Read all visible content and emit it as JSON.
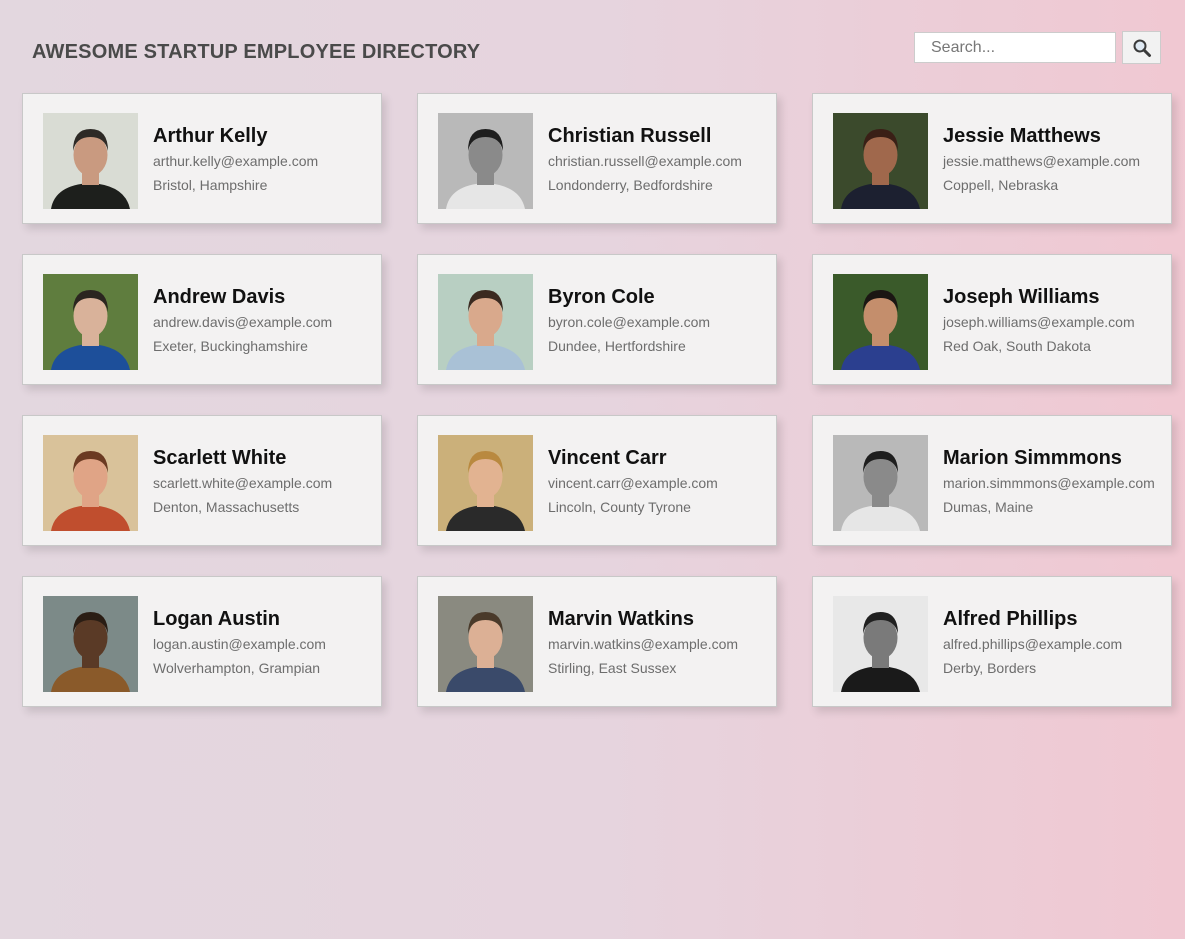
{
  "header": {
    "title": "AWESOME STARTUP EMPLOYEE DIRECTORY",
    "search_placeholder": "Search..."
  },
  "employees": [
    {
      "name": "Arthur Kelly",
      "email": "arthur.kelly@example.com",
      "location": "Bristol, Hampshire",
      "bg": "#d9dcd4",
      "skin": "#c99a80",
      "hair": "#2e2a26",
      "shirt": "#1d1f1c"
    },
    {
      "name": "Christian Russell",
      "email": "christian.russell@example.com",
      "location": "Londonderry, Bedfordshire",
      "bg": "#b9b9b9",
      "skin": "#8a8a8a",
      "hair": "#1e1e1e",
      "shirt": "#e6e6e6"
    },
    {
      "name": "Jessie Matthews",
      "email": "jessie.matthews@example.com",
      "location": "Coppell, Nebraska",
      "bg": "#3b4a2c",
      "skin": "#a0684c",
      "hair": "#3a1f16",
      "shirt": "#1c2030"
    },
    {
      "name": "Andrew Davis",
      "email": "andrew.davis@example.com",
      "location": "Exeter, Buckinghamshire",
      "bg": "#5f7d3e",
      "skin": "#d9b29a",
      "hair": "#2b2520",
      "shirt": "#1d4f9a"
    },
    {
      "name": "Byron Cole",
      "email": "byron.cole@example.com",
      "location": "Dundee, Hertfordshire",
      "bg": "#b8cfc2",
      "skin": "#d9a98c",
      "hair": "#3b2a20",
      "shirt": "#a9c1d6"
    },
    {
      "name": "Joseph Williams",
      "email": "joseph.williams@example.com",
      "location": "Red Oak, South Dakota",
      "bg": "#3a5a2a",
      "skin": "#c48e6c",
      "hair": "#1b1613",
      "shirt": "#2b3f8f"
    },
    {
      "name": "Scarlett White",
      "email": "scarlett.white@example.com",
      "location": "Denton, Massachusetts",
      "bg": "#d9c29a",
      "skin": "#e0a486",
      "hair": "#6b3a22",
      "shirt": "#c04e2e"
    },
    {
      "name": "Vincent Carr",
      "email": "vincent.carr@example.com",
      "location": "Lincoln, County Tyrone",
      "bg": "#cbb07a",
      "skin": "#e2b391",
      "hair": "#b9893f",
      "shirt": "#2a2a2a"
    },
    {
      "name": "Marion Simmmons",
      "email": "marion.simmmons@example.com",
      "location": "Dumas, Maine",
      "bg": "#b9b9b9",
      "skin": "#8a8a8a",
      "hair": "#1e1e1e",
      "shirt": "#e6e6e6"
    },
    {
      "name": "Logan Austin",
      "email": "logan.austin@example.com",
      "location": "Wolverhampton, Grampian",
      "bg": "#7c8a88",
      "skin": "#5a3a26",
      "hair": "#2a1d14",
      "shirt": "#8a5a2a"
    },
    {
      "name": "Marvin Watkins",
      "email": "marvin.watkins@example.com",
      "location": "Stirling, East Sussex",
      "bg": "#8a8a80",
      "skin": "#dcb095",
      "hair": "#4a3a2a",
      "shirt": "#3a4a6a"
    },
    {
      "name": "Alfred Phillips",
      "email": "alfred.phillips@example.com",
      "location": "Derby, Borders",
      "bg": "#e8e8e8",
      "skin": "#7a7a7a",
      "hair": "#202020",
      "shirt": "#1a1a1a"
    }
  ]
}
